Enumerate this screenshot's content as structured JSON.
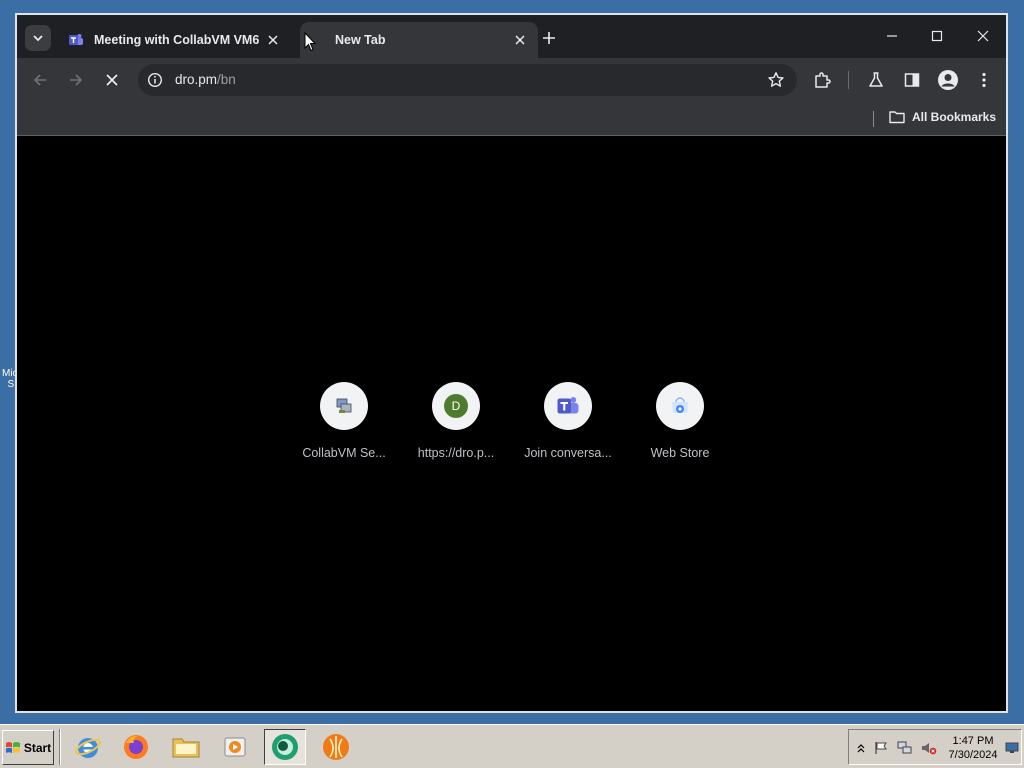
{
  "browser": {
    "tabs": [
      {
        "title": "Meeting with CollabVM VM6 |",
        "active": false
      },
      {
        "title": "New Tab",
        "active": true
      }
    ],
    "url_host": "dro.pm",
    "url_path": "/bn",
    "bookmarks_bar": {
      "all_bookmarks_label": "All Bookmarks"
    },
    "shortcuts": [
      {
        "label": "CollabVM Se...",
        "icon": "collabvm-icon"
      },
      {
        "label": "https://dro.p...",
        "icon": "letter-d-icon",
        "letter": "D"
      },
      {
        "label": "Join conversa...",
        "icon": "teams-icon"
      },
      {
        "label": "Web Store",
        "icon": "web-store-icon"
      }
    ]
  },
  "taskbar": {
    "start_label": "Start",
    "quick_launch": [
      "internet-explorer-icon",
      "firefox-icon",
      "folder-icon",
      "media-player-icon",
      "chrome-icon",
      "vlc-icon"
    ],
    "clock_time": "1:47 PM",
    "clock_date": "7/30/2024"
  },
  "colors": {
    "desktop": "#3a6ea5",
    "titlebar": "#1f2023",
    "toolbar": "#35363a",
    "omnibox": "#28292c",
    "page_bg": "#000000",
    "taskbar": "#d4d0c8"
  }
}
